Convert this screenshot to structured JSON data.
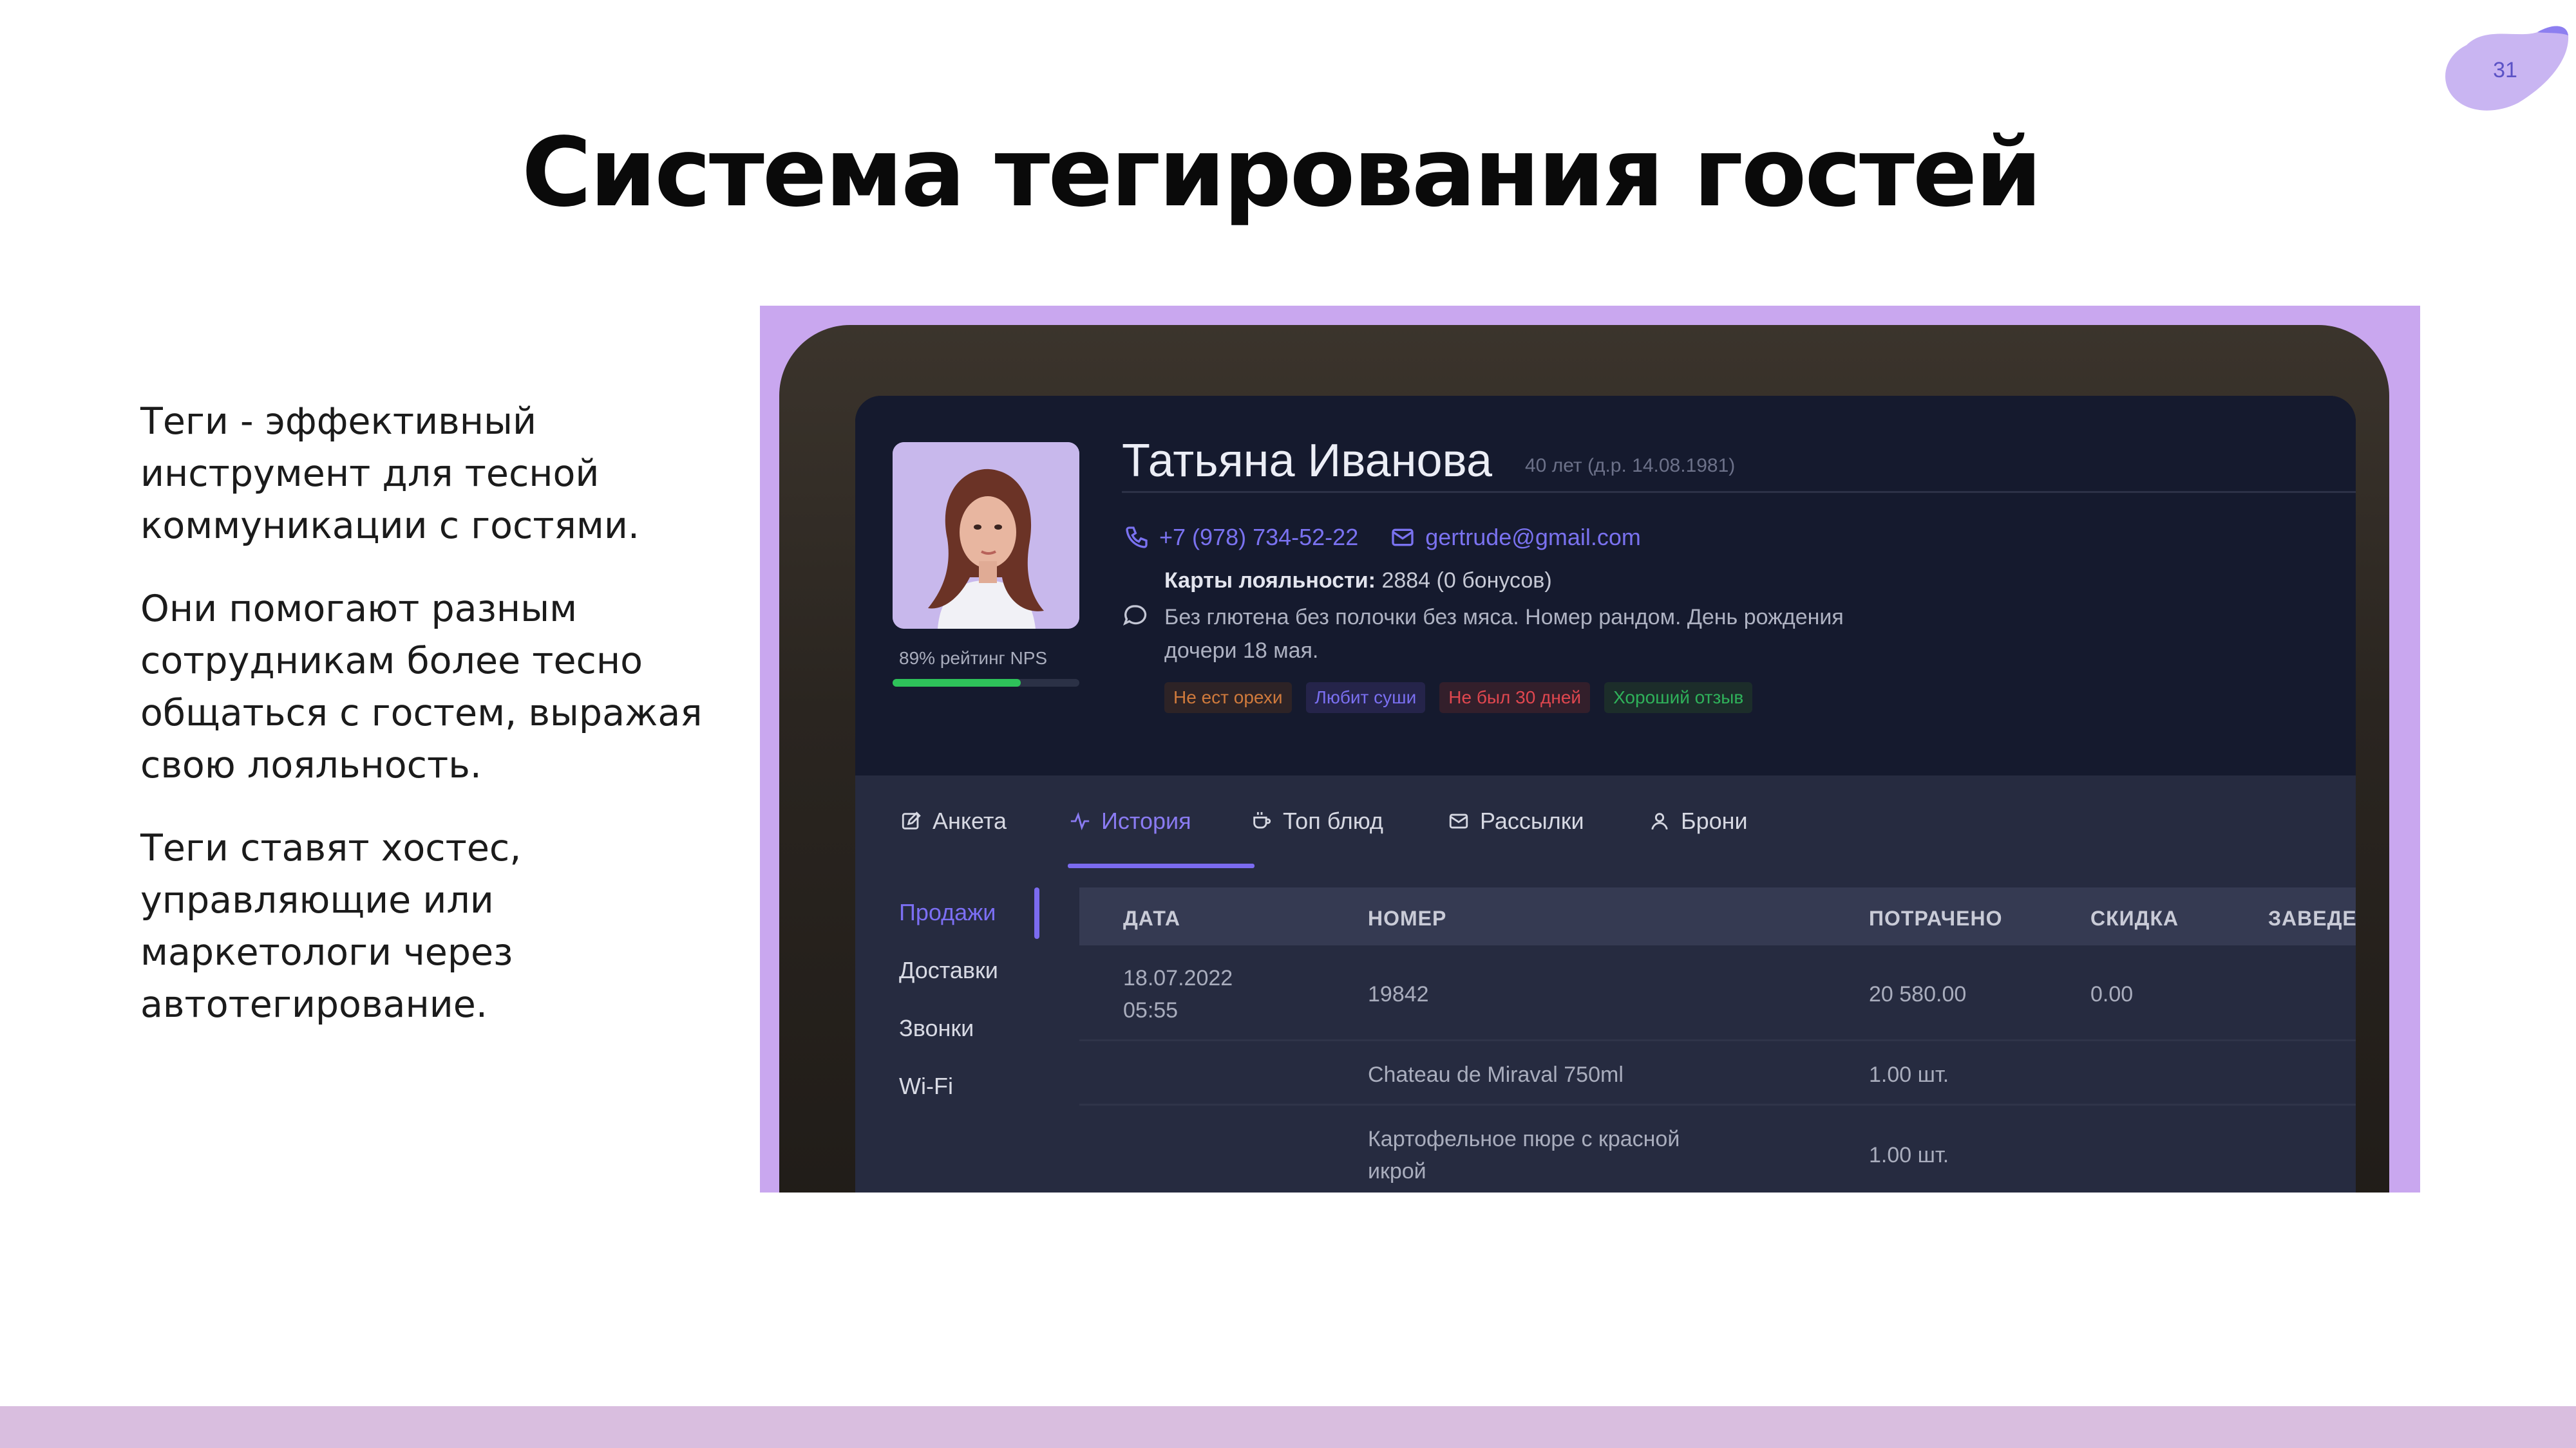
{
  "slide": {
    "title": "Система тегирования гостей",
    "page_number": "31",
    "paragraphs": [
      "Теги - эффективный инструмент для тесной коммуникации с гостями.",
      "Они помогают разным сотрудникам более тесно общаться с гостем, выражая свою лояльность.",
      "Теги ставят хостес, управляющие или маркетологи через автотегирование."
    ],
    "accent_color": "#c9a7ef",
    "bar_color": "#d9bedf"
  },
  "guest": {
    "name": "Татьяна Иванова",
    "age_note": "40 лет (д.р. 14.08.1981)",
    "phone": "+7 (978) 734-52-22",
    "email": "gertrude@gmail.com",
    "loyalty_label": "Карты лояльности:",
    "loyalty_value": "2884 (0 бонусов)",
    "comment": "Без глютена без полочки без мяса. Номер рандом. День рождения дочери 18 мая.",
    "nps_label": "89% рейтинг NPS",
    "nps_percent": 89,
    "tags": [
      {
        "label": "Не ест орехи",
        "color": "#d07a3c",
        "bg": "#2d2326"
      },
      {
        "label": "Любит суши",
        "color": "#7a6ff0",
        "bg": "#25244a"
      },
      {
        "label": "Не был 30 дней",
        "color": "#e0474f",
        "bg": "#331f2b"
      },
      {
        "label": "Хороший отзыв",
        "color": "#2fb15a",
        "bg": "#1c2d2a"
      }
    ]
  },
  "tabs": [
    {
      "label": "Анкета",
      "icon": "edit-icon"
    },
    {
      "label": "История",
      "icon": "activity-icon"
    },
    {
      "label": "Топ блюд",
      "icon": "cup-icon"
    },
    {
      "label": "Рассылки",
      "icon": "mail-icon"
    },
    {
      "label": "Брони",
      "icon": "user-icon"
    }
  ],
  "active_tab": "История",
  "sidebar": [
    "Продажи",
    "Доставки",
    "Звонки",
    "Wi-Fi"
  ],
  "table": {
    "headers": [
      "ДАТА",
      "НОМЕР",
      "ПОТРАЧЕНО",
      "СКИДКА",
      "ЗАВЕДЕ"
    ],
    "rows": [
      {
        "date": "18.07.2022",
        "time": "05:55",
        "number": "19842",
        "spent": "20 580.00",
        "discount": "0.00"
      },
      {
        "item": "Chateau de Miraval 750ml",
        "qty": "1.00 шт."
      },
      {
        "item_line1": "Картофельное пюре с красной",
        "item_line2": "икрой",
        "qty": "1.00 шт."
      }
    ]
  }
}
